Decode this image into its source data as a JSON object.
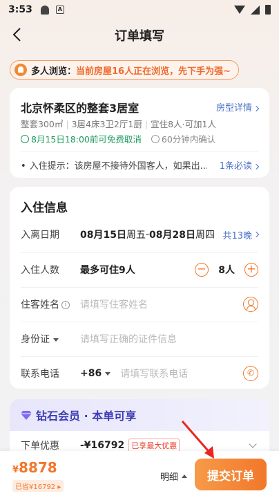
{
  "status_bar": {
    "time": "3:53"
  },
  "header": {
    "title": "订单填写"
  },
  "notice": {
    "label": "多人浏览：",
    "message": "当前房屋16人正在浏览，先下手为强~"
  },
  "house": {
    "title": "北京怀柔区的整套3居室",
    "detail_link": "房型详情",
    "specs": [
      "整套300㎡",
      "3居4床3卫2厅1厨",
      "宜住8人·可加1人"
    ],
    "free_cancel": "8月15日18:00前可免费取消",
    "confirm": "60分钟内确认",
    "checkin_tip": "入住提示：该房屋不接待外国客人，如果出...",
    "rules_link": "1条必读"
  },
  "checkin_info": {
    "title": "入住信息",
    "dates": {
      "label": "入离日期",
      "start": "08月15日",
      "start_week": "周五",
      "dash": "-",
      "end": "08月28日",
      "end_week": "周四",
      "nights": "共13晚"
    },
    "guests": {
      "label": "入住人数",
      "max": "最多可住9人",
      "count": "8人",
      "minus": "−",
      "plus": "+"
    },
    "guest_name": {
      "label": "住客姓名",
      "info": "i",
      "placeholder": "请填写住客姓名"
    },
    "id": {
      "label": "身份证",
      "placeholder": "请填写正确的证件信息"
    },
    "phone": {
      "label": "联系电话",
      "code": "+86",
      "placeholder": "请填写联系电话",
      "icon_glyph": "✆"
    }
  },
  "vip": {
    "title": "钻石会员 · 本单可享",
    "discount_label": "下单优惠",
    "discount_amount": "-¥16792",
    "discount_badge": "已享最大优惠"
  },
  "footer": {
    "currency": "¥",
    "price": "8878",
    "saved": "已省¥16792 ▸",
    "detail": "明细",
    "submit": "提交订单"
  },
  "colors": {
    "accent": "#f2772b",
    "link": "#4a71c8",
    "green": "#1e9b5e",
    "vip": "#3b3bb5"
  }
}
